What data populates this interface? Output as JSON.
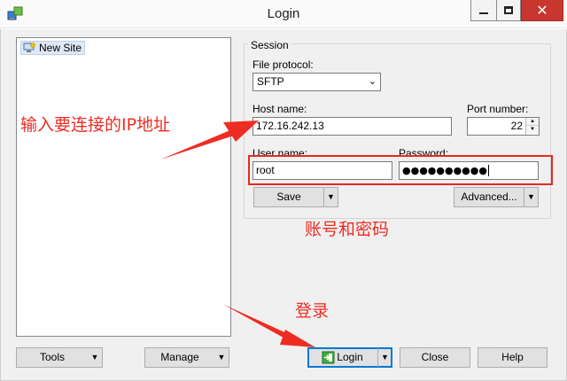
{
  "window": {
    "title": "Login",
    "controls": {
      "minimize_icon": "minimize-icon",
      "maximize_icon": "maximize-icon",
      "close_icon": "close-icon"
    }
  },
  "site_tree": {
    "items": [
      {
        "label": "New Site",
        "icon": "new-site-icon"
      }
    ]
  },
  "session": {
    "group_label": "Session",
    "file_protocol": {
      "label": "File protocol:",
      "value": "SFTP"
    },
    "host_name": {
      "label": "Host name:",
      "value": "172.16.242.13"
    },
    "port_number": {
      "label": "Port number:",
      "value": "22"
    },
    "user_name": {
      "label": "User name:",
      "value": "root"
    },
    "password": {
      "label": "Password:",
      "masked_value": "●●●●●●●●●●"
    },
    "save_button": "Save",
    "advanced_button": "Advanced..."
  },
  "bottom_bar": {
    "tools": "Tools",
    "manage": "Manage",
    "login": "Login",
    "close": "Close",
    "help": "Help"
  },
  "annotations": {
    "host_hint": "输入要连接的IP地址",
    "credentials_hint": "账号和密码",
    "login_hint": "登录",
    "color": "#ef2c23"
  }
}
